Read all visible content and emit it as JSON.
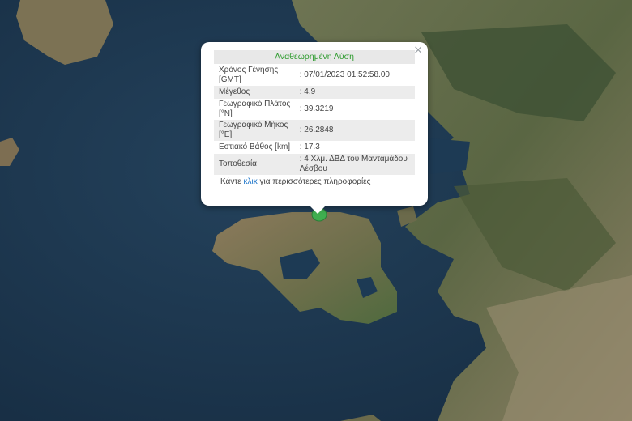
{
  "popup": {
    "title": "Αναθεωρημένη Λύση",
    "close_symbol": "×",
    "rows": [
      {
        "label": "Χρόνος Γένησης [GMT]",
        "value": ": 07/01/2023 01:52:58.00"
      },
      {
        "label": "Μέγεθος",
        "value": ": 4.9"
      },
      {
        "label": "Γεωγραφικό Πλάτος [°N]",
        "value": ": 39.3219"
      },
      {
        "label": "Γεωγραφικό Μήκος [°E]",
        "value": ": 26.2848"
      },
      {
        "label": "Εστιακό Βάθος [km]",
        "value": ": 17.3"
      },
      {
        "label": "Τοποθεσία",
        "value": ": 4 Χλμ. ΔΒΔ του Μανταμάδου Λέσβου"
      }
    ],
    "more_prefix": "Κάντε ",
    "more_link": "κλικ",
    "more_suffix": " για περισσότερες πληροφορίες"
  },
  "marker": {
    "icon": "epicenter-marker-icon",
    "color": "#3fae4f"
  },
  "colors": {
    "sea": "#1f3a52",
    "land": "#5d6a46",
    "title_green": "#2e9b2e",
    "link_blue": "#1a73c8"
  }
}
